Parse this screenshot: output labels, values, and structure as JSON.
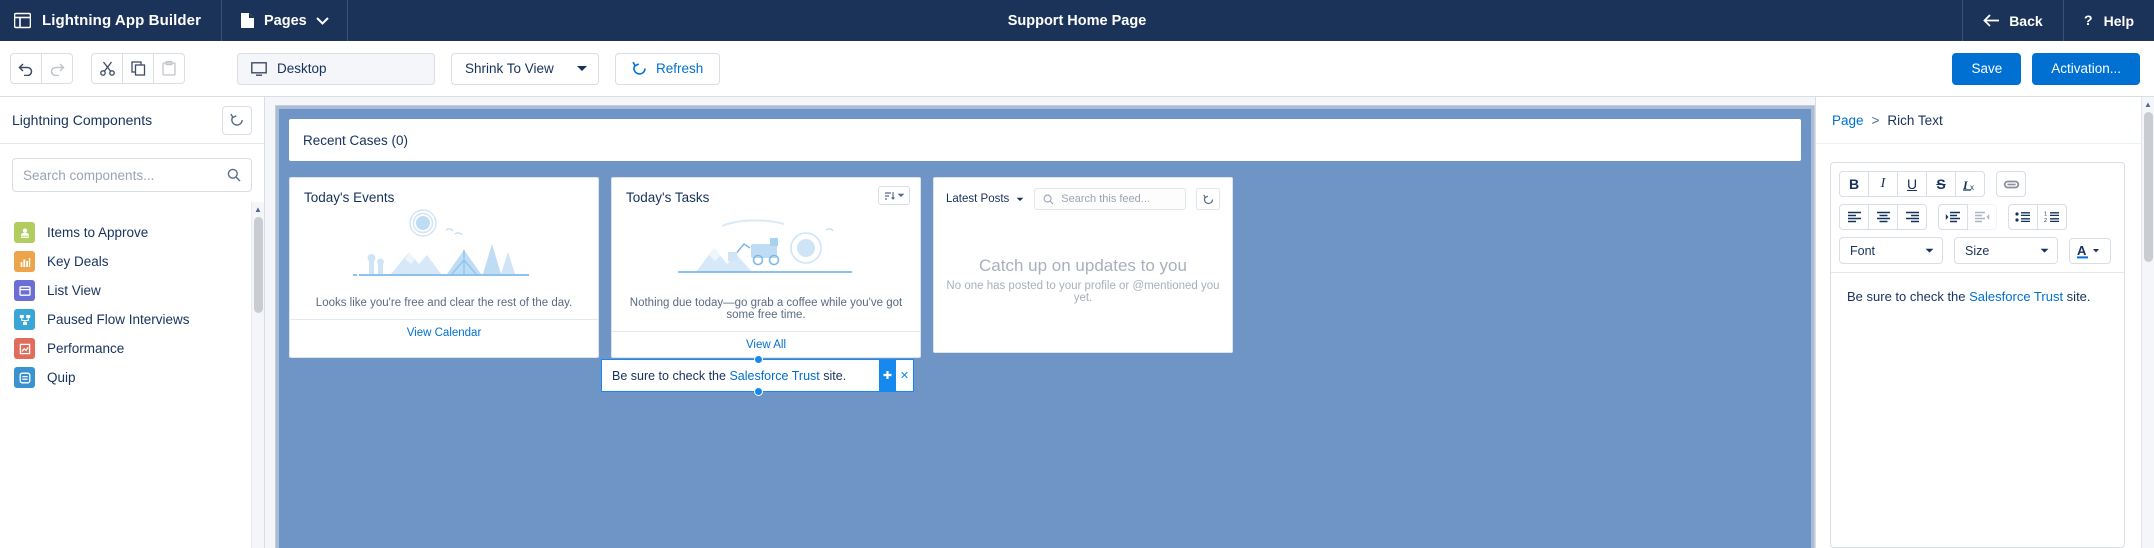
{
  "header": {
    "brand": "Lightning App Builder",
    "brand_icon": "app-builder-icon",
    "pages_label": "Pages",
    "pages_icon": "page-icon",
    "title": "Support Home Page",
    "back_label": "Back",
    "help_label": "Help"
  },
  "toolbar": {
    "undo_icon": "undo-icon",
    "redo_icon": "redo-icon",
    "cut_icon": "scissors-icon",
    "copy_icon": "copy-icon",
    "paste_icon": "paste-icon",
    "viewport": "Desktop",
    "viewport_icon": "desktop-icon",
    "shrink": "Shrink To View",
    "refresh": "Refresh",
    "refresh_icon": "refresh-icon",
    "save_label": "Save",
    "activation_label": "Activation...",
    "accent": "#0070d2"
  },
  "left_panel": {
    "title": "Lightning Components",
    "refresh_icon": "refresh-icon",
    "search_placeholder": "Search components...",
    "search_value": "",
    "search_icon": "search-icon",
    "components": [
      {
        "label": "Items to Approve",
        "icon": "approval-icon",
        "color": "#b2cc60"
      },
      {
        "label": "Key Deals",
        "icon": "bar-chart-icon",
        "color": "#eda44b"
      },
      {
        "label": "List View",
        "icon": "list-view-icon",
        "color": "#6b6fd4"
      },
      {
        "label": "Paused Flow Interviews",
        "icon": "flow-icon",
        "color": "#3aa6d8"
      },
      {
        "label": "Performance",
        "icon": "performance-icon",
        "color": "#e06c5c"
      },
      {
        "label": "Quip",
        "icon": "quip-icon",
        "color": "#3a93d0"
      }
    ]
  },
  "canvas": {
    "recent_cases": "Recent Cases (0)",
    "events": {
      "title": "Today's Events",
      "illustration": "camping-illustration",
      "subtitle": "Looks like you're free and clear the rest of the day.",
      "footer": "View Calendar"
    },
    "tasks": {
      "title": "Today's Tasks",
      "illustration": "tasks-illustration",
      "subtitle": "Nothing due today—go grab a coffee while you've got some free time.",
      "footer": "View All",
      "sort_icon": "sort-icon"
    },
    "feed": {
      "filter": "Latest Posts",
      "search_placeholder": "Search this feed...",
      "search_icon": "search-icon",
      "refresh_icon": "refresh-icon",
      "empty_title": "Catch up on updates to you",
      "empty_sub": "No one has posted to your profile or @mentioned you yet."
    },
    "selected_rich_text": {
      "prefix": "Be sure to check the ",
      "link": "Salesforce Trust",
      "suffix": " site.",
      "move_icon": "move-icon",
      "close_icon": "close-icon",
      "selection_color": "#1589ee"
    }
  },
  "right_panel": {
    "breadcrumb_root": "Page",
    "breadcrumb_sep": ">",
    "breadcrumb_current": "Rich Text",
    "editor": {
      "bold": "B",
      "italic": "I",
      "underline": "U",
      "strike": "S",
      "clear_format": "Ix",
      "link_icon": "link-icon",
      "align_left_icon": "align-left-icon",
      "align_center_icon": "align-center-icon",
      "align_right_icon": "align-right-icon",
      "indent_icon": "indent-icon",
      "outdent_icon": "outdent-icon",
      "bullet_list_icon": "bullet-list-icon",
      "numbered_list_icon": "numbered-list-icon",
      "font_label": "Font",
      "size_label": "Size",
      "text_color_icon": "text-color-icon",
      "content_prefix": "Be sure to check the ",
      "content_link": "Salesforce Trust",
      "content_suffix": " site."
    }
  }
}
